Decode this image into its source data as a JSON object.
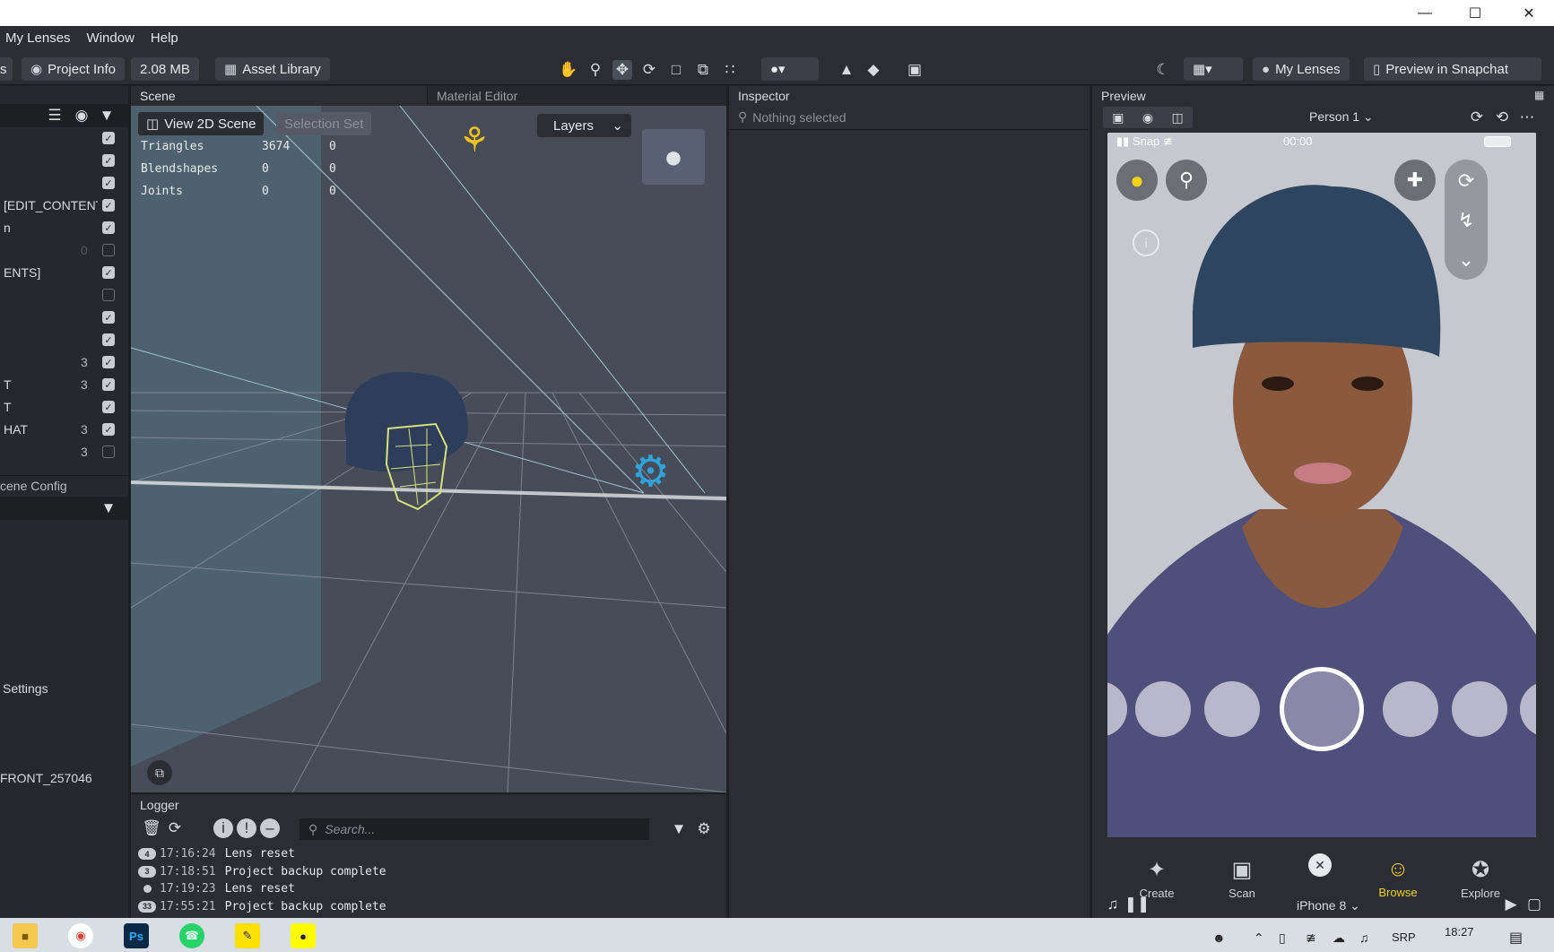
{
  "menu": [
    "My Lenses",
    "Window",
    "Help"
  ],
  "toolbar": {
    "left_cut": "s",
    "project_info": "Project Info",
    "size": "2.08 MB",
    "asset_library": "Asset Library",
    "my_lenses": "My Lenses",
    "preview_in_snapchat": "Preview in Snapchat"
  },
  "hierarchy": {
    "rows": [
      {
        "label": "",
        "num": "",
        "checked": true
      },
      {
        "label": "",
        "num": "",
        "checked": true
      },
      {
        "label": "",
        "num": "",
        "checked": true
      },
      {
        "label": "[EDIT_CONTENT",
        "num": "",
        "checked": true
      },
      {
        "label": "n",
        "num": "",
        "checked": true
      },
      {
        "label": "",
        "num": "0",
        "checked": false,
        "dim": true
      },
      {
        "label": "ENTS]",
        "num": "",
        "checked": true
      },
      {
        "label": "",
        "num": "",
        "checked": false
      },
      {
        "label": "",
        "num": "",
        "checked": true
      },
      {
        "label": "",
        "num": "",
        "checked": true
      },
      {
        "label": "",
        "num": "3",
        "checked": true
      },
      {
        "label": "T",
        "num": "3",
        "checked": true
      },
      {
        "label": "T",
        "num": "",
        "checked": true
      },
      {
        "label": "HAT",
        "num": "3",
        "checked": true
      },
      {
        "label": "",
        "num": "3",
        "checked": false
      }
    ],
    "scene_config": "cene Config",
    "settings": "Settings",
    "front_item": "FRONT_257046"
  },
  "scene": {
    "tab_scene": "Scene",
    "tab_material": "Material Editor",
    "view2d": "View 2D Scene",
    "selection_set": "Selection Set",
    "layers": "Layers",
    "stats": [
      {
        "name": "Triangles",
        "v1": "3674",
        "v2": "0"
      },
      {
        "name": "Blendshapes",
        "v1": "0",
        "v2": "0"
      },
      {
        "name": "Joints",
        "v1": "0",
        "v2": "0"
      }
    ]
  },
  "logger": {
    "title": "Logger",
    "search_placeholder": "Search...",
    "lines": [
      {
        "badge": "4",
        "time": "17:16:24",
        "msg": "Lens reset"
      },
      {
        "badge": "3",
        "time": "17:18:51",
        "msg": "Project backup complete"
      },
      {
        "badge": "",
        "time": "17:19:23",
        "msg": "Lens reset"
      },
      {
        "badge": "33",
        "time": "17:55:21",
        "msg": "Project backup complete"
      }
    ]
  },
  "inspector": {
    "title": "Inspector",
    "empty": "Nothing selected"
  },
  "preview": {
    "title": "Preview",
    "person": "Person 1",
    "carrier": "Snap",
    "clock": "00:00",
    "device": "iPhone 8",
    "nav": [
      "Create",
      "Scan",
      "Browse",
      "Explore"
    ]
  },
  "taskbar": {
    "lang": "SRP",
    "time": "18:27"
  },
  "colors": {
    "accent_yellow": "#f7d417",
    "scene_bg": "#474c59",
    "panel_bg": "#2b2d33"
  }
}
